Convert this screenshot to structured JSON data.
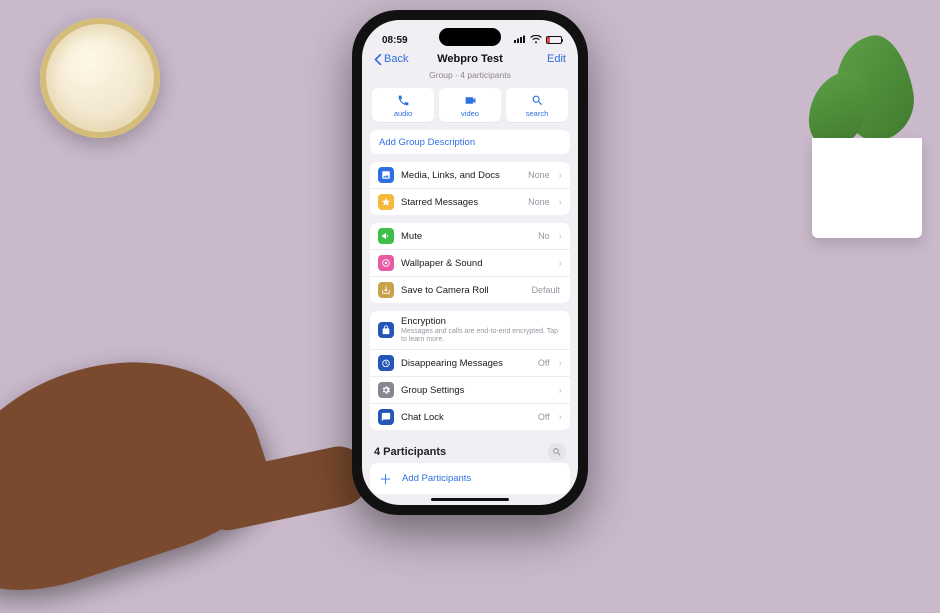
{
  "status": {
    "time": "08:59"
  },
  "nav": {
    "back": "Back",
    "title": "Webpro Test",
    "edit": "Edit"
  },
  "subtitle": "Group · 4 participants",
  "actions": {
    "audio": "audio",
    "video": "video",
    "search": "search"
  },
  "add_description": "Add Group Description",
  "rows": {
    "media": {
      "label": "Media, Links, and Docs",
      "detail": "None"
    },
    "starred": {
      "label": "Starred Messages",
      "detail": "None"
    },
    "mute": {
      "label": "Mute",
      "detail": "No"
    },
    "wallpaper": {
      "label": "Wallpaper & Sound"
    },
    "camera_roll": {
      "label": "Save to Camera Roll",
      "detail": "Default"
    },
    "encryption": {
      "label": "Encryption",
      "sub": "Messages and calls are end-to-end encrypted. Tap to learn more."
    },
    "disappearing": {
      "label": "Disappearing Messages",
      "detail": "Off"
    },
    "group_settings": {
      "label": "Group Settings"
    },
    "chat_lock": {
      "label": "Chat Lock",
      "detail": "Off"
    }
  },
  "participants": {
    "header": "4 Participants",
    "add": "Add Participants"
  }
}
